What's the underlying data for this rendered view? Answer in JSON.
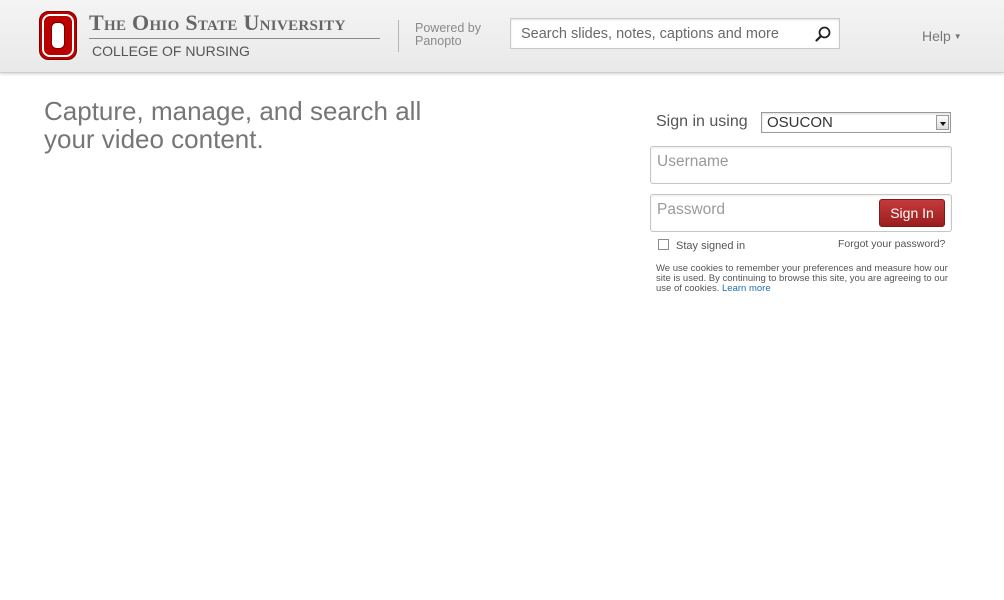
{
  "header": {
    "university_name": "The Ohio State University",
    "college_name": "COLLEGE OF NURSING",
    "powered_by_line1": "Powered by",
    "powered_by_line2": "Panopto",
    "search_placeholder": "Search slides, notes, captions and more",
    "search_icon": "search-icon",
    "help_label": "Help",
    "help_icon": "caret-down-icon"
  },
  "colors": {
    "brand_red": "#bb0000",
    "sign_in_button": "#a82424",
    "link": "#1f6fb0"
  },
  "main": {
    "tagline": "Capture, manage, and search all your video content."
  },
  "login": {
    "sign_in_using_label": "Sign in using",
    "provider_selected": "OSUCON",
    "username_placeholder": "Username",
    "password_placeholder": "Password",
    "sign_in_button": "Sign In",
    "stay_signed_in_label": "Stay signed in",
    "forgot_password_link": "Forgot your password?",
    "cookie_notice": "We use cookies to remember your preferences and measure how our site is used. By continuing to browse this site, you are agreeing to our use of cookies.",
    "learn_more_link": "Learn more"
  }
}
